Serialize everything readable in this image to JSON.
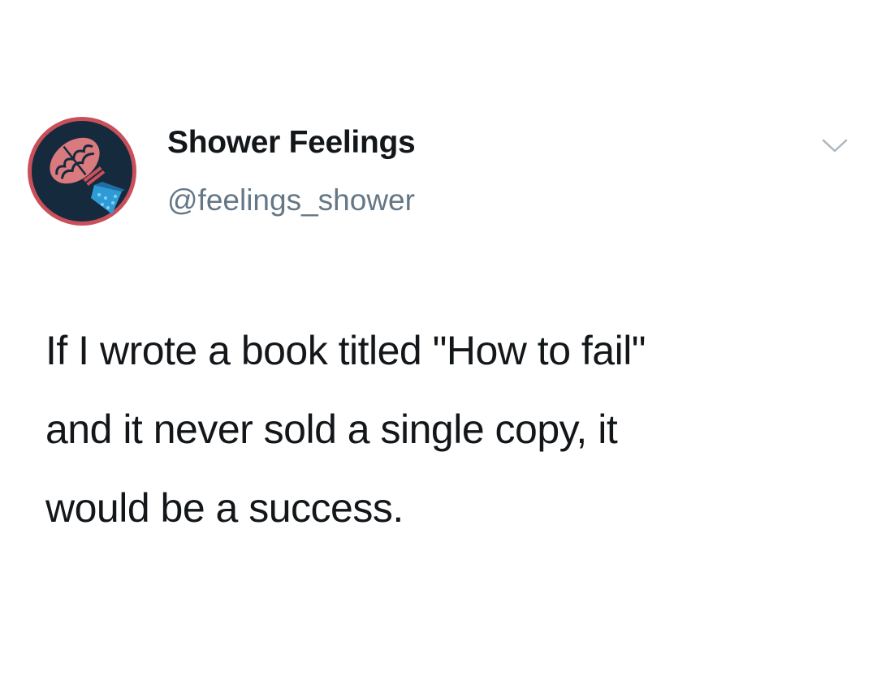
{
  "tweet": {
    "author": {
      "display_name": "Shower Feelings",
      "handle": "@feelings_shower",
      "avatar_icon": "brain-shower-head-icon"
    },
    "menu_icon": "chevron-down-icon",
    "text_lines": [
      "If I wrote a book titled \"How to fail\"",
      "and it never sold a single copy, it",
      "would be a success."
    ]
  },
  "colors": {
    "text_primary": "#14171a",
    "text_secondary": "#657786",
    "avatar_ring": "#c9505a",
    "avatar_bg": "#152a3c",
    "brain_pink": "#d97a7e",
    "shower_blue": "#2f9bd6",
    "chevron_gray": "#aab8c2"
  }
}
